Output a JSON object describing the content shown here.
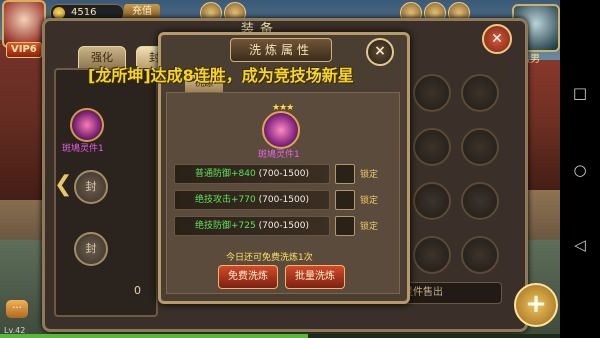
{
  "hud": {
    "vip": "VIP6",
    "gold_amount": "4516",
    "charge_label": "充值",
    "top_right_hero": "铁猛男",
    "level": "Lv.42",
    "progress_fraction": 0.55
  },
  "equipment_panel": {
    "title": "装备",
    "tabs": [
      "强化",
      "封灵"
    ],
    "seal_label": "封",
    "left_spirit_label": "斑鳩灵件1",
    "diamond_count": "0",
    "sell_label": "一键灵件售出",
    "plus_label": "+"
  },
  "wash_dialog": {
    "title": "洗炼属性",
    "tab": "洗炼",
    "close_icon": "×",
    "stars": "★★★",
    "spirit_label": "斑鳩灵件1",
    "stats": [
      {
        "name": "普通防御",
        "bonus": "+840",
        "range": "(700-1500)",
        "lock_label": "锁定"
      },
      {
        "name": "绝技攻击",
        "bonus": "+770",
        "range": "(700-1500)",
        "lock_label": "锁定"
      },
      {
        "name": "绝技防御",
        "bonus": "+725",
        "range": "(700-1500)",
        "lock_label": "锁定"
      }
    ],
    "free_text": "今日还可免费洗炼1次",
    "buttons": {
      "free": "免费洗炼",
      "batch": "批量洗炼"
    }
  },
  "broadcast": "[龙所坤]达成8连胜，成为竞技场新星",
  "android_nav": {
    "square": "□",
    "circle": "○",
    "back": "◁"
  }
}
